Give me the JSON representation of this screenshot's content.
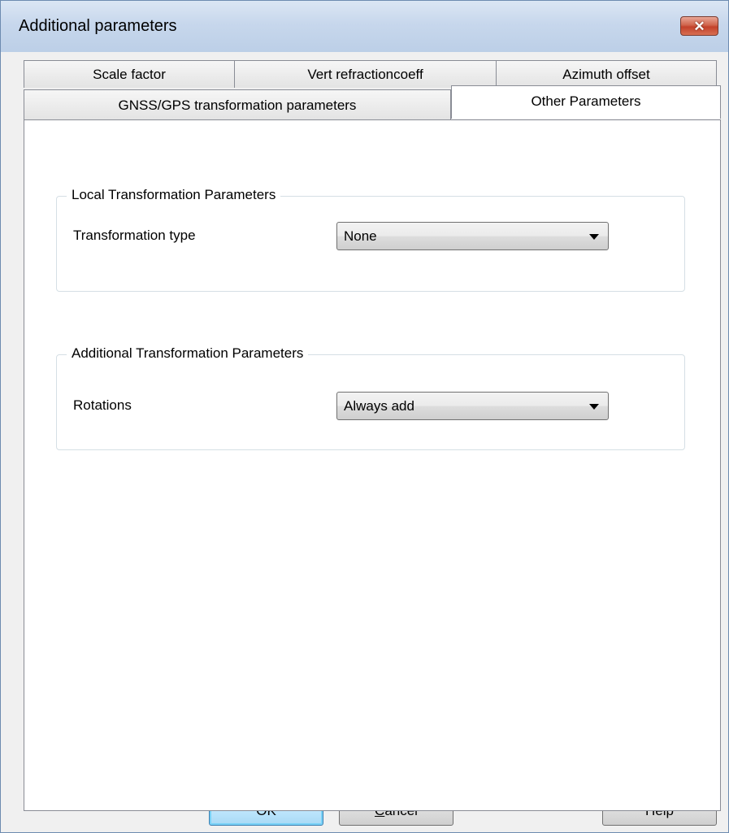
{
  "window": {
    "title": "Additional parameters",
    "close_symbol": "✕"
  },
  "tabs": {
    "row_back": [
      "Scale factor",
      "Vert refractioncoeff",
      "Azimuth offset"
    ],
    "row_front": [
      "GNSS/GPS transformation parameters",
      "Other Parameters"
    ],
    "selected": "Other Parameters"
  },
  "local_group": {
    "legend": "Local Transformation Parameters",
    "transformation_type_label": "Transformation type",
    "transformation_type_value": "None"
  },
  "additional_group": {
    "legend": "Additional Transformation Parameters",
    "rotations_label": "Rotations",
    "rotations_value": "Always add"
  },
  "buttons": {
    "ok": "OK",
    "cancel_mnemonic": "C",
    "cancel_rest": "ancel",
    "help": "Help"
  },
  "icons": {
    "close": "close-icon",
    "dropdown": "chevron-down-icon"
  }
}
